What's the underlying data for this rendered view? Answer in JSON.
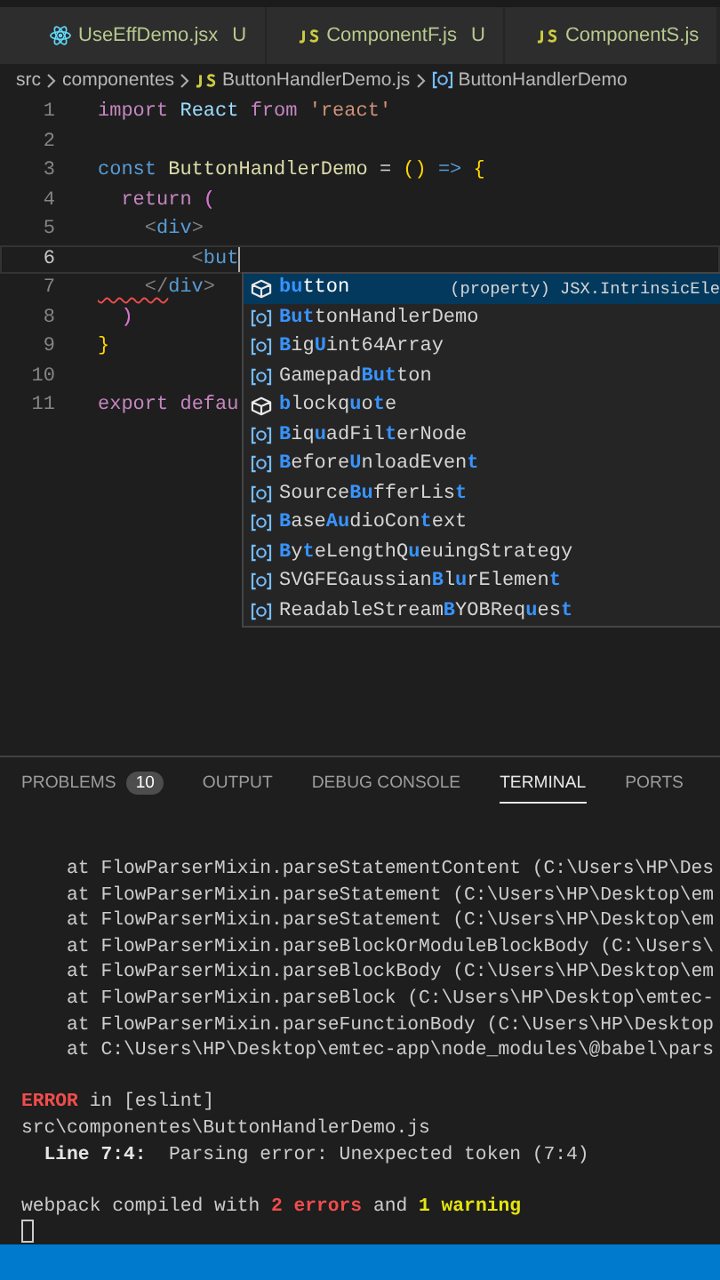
{
  "editor_tabs": [
    {
      "label": "UseEffDemo.jsx",
      "kind": "jsx",
      "status": "U",
      "selected": false
    },
    {
      "label": "ComponentF.js",
      "kind": "js",
      "status": "U",
      "selected": false
    },
    {
      "label": "ComponentS.js",
      "kind": "js",
      "selected": false
    }
  ],
  "breadcrumb": [
    {
      "label": "src",
      "kind": "folder"
    },
    {
      "label": "componentes",
      "kind": "folder"
    },
    {
      "label": "ButtonHandlerDemo.js",
      "kind": "file"
    },
    {
      "label": "ButtonHandlerDemo",
      "kind": "symbol"
    }
  ],
  "code_lines": [
    {
      "number": "1",
      "current": false,
      "error": false,
      "tokens": [
        {
          "text": "import ",
          "kind": "control"
        },
        {
          "text": "React ",
          "kind": "variable"
        },
        {
          "text": "from ",
          "kind": "control"
        },
        {
          "text": "'react'",
          "kind": "string"
        }
      ]
    },
    {
      "number": "2",
      "current": false,
      "error": false
    },
    {
      "number": "3",
      "current": false,
      "error": false,
      "tokens": [
        {
          "text": "const ",
          "kind": "keyword"
        },
        {
          "text": "ButtonHandlerDemo ",
          "kind": "function"
        },
        {
          "text": "= ",
          "kind": "plain"
        },
        {
          "text": "() ",
          "kind": "bracket"
        },
        {
          "text": "=> ",
          "kind": "keyword"
        },
        {
          "text": "{",
          "kind": "bracket"
        }
      ]
    },
    {
      "number": "4",
      "current": false,
      "error": false,
      "tokens": [
        {
          "text": "  return ",
          "kind": "control"
        },
        {
          "text": "(",
          "kind": "match"
        }
      ]
    },
    {
      "number": "5",
      "current": false,
      "error": false,
      "tokens": [
        {
          "text": "    <",
          "kind": "tagpunct"
        },
        {
          "text": "div",
          "kind": "tag"
        },
        {
          "text": ">",
          "kind": "tagpunct"
        }
      ]
    },
    {
      "number": "6",
      "current": true,
      "error": false,
      "tokens": [
        {
          "text": "        <",
          "kind": "tagpunct"
        },
        {
          "text": "but",
          "kind": "tag"
        }
      ]
    },
    {
      "number": "7",
      "current": false,
      "error": true,
      "tokens": [
        {
          "text": "    </",
          "kind": "tagpunct"
        },
        {
          "text": "div",
          "kind": "tag"
        },
        {
          "text": ">",
          "kind": "tagpunct"
        }
      ]
    },
    {
      "number": "8",
      "current": false,
      "error": false,
      "tokens": [
        {
          "text": "  )",
          "kind": "match"
        }
      ]
    },
    {
      "number": "9",
      "current": false,
      "error": false,
      "tokens": [
        {
          "text": "}",
          "kind": "bracket"
        }
      ]
    },
    {
      "number": "10",
      "current": false,
      "error": false
    },
    {
      "number": "11",
      "current": false,
      "error": false,
      "tokens": [
        {
          "text": "export ",
          "kind": "control"
        },
        {
          "text": "defau",
          "kind": "control"
        }
      ]
    }
  ],
  "suggestions": [
    {
      "kind": "property",
      "selected": true,
      "label": "**bu**tton",
      "detail": "(property) JSX.IntrinsicEle"
    },
    {
      "kind": "variable",
      "selected": false,
      "label": "**But**tonHandlerDemo"
    },
    {
      "kind": "variable",
      "selected": false,
      "label": "**B**ig**U**int64Array"
    },
    {
      "kind": "variable",
      "selected": false,
      "label": "Gamepad**But**ton"
    },
    {
      "kind": "property",
      "selected": false,
      "label": "**b**lockq**u**o**t**e"
    },
    {
      "kind": "variable",
      "selected": false,
      "label": "**B**iq**u**adFil**t**erNode"
    },
    {
      "kind": "variable",
      "selected": false,
      "label": "**B**efore**U**nloadEven**t**"
    },
    {
      "kind": "variable",
      "selected": false,
      "label": "Source**Bu**fferLis**t**"
    },
    {
      "kind": "variable",
      "selected": false,
      "label": "**B**ase**Au**dioCon**t**ext"
    },
    {
      "kind": "variable",
      "selected": false,
      "label": "**B**y**t**eLengthQ**u**euingStrategy"
    },
    {
      "kind": "variable",
      "selected": false,
      "label": "SVGFEGaussian**B**l**u**rElemen**t**"
    },
    {
      "kind": "variable",
      "selected": false,
      "label": "ReadableStream**B**YOBReq**u**es**t**"
    }
  ],
  "panel_tabs": [
    {
      "label": "PROBLEMS",
      "badge": "10",
      "selected": false
    },
    {
      "label": "OUTPUT",
      "selected": false
    },
    {
      "label": "DEBUG CONSOLE",
      "selected": false
    },
    {
      "label": "TERMINAL",
      "selected": true
    },
    {
      "label": "PORTS",
      "selected": false
    }
  ],
  "terminal_lines": [
    [
      {
        "text": "    at FlowParserMixin.parseStatementContent (C:\\Users\\HP\\Des",
        "kind": "plain"
      }
    ],
    [
      {
        "text": "    at FlowParserMixin.parseStatement (C:\\Users\\HP\\Desktop\\em",
        "kind": "plain"
      }
    ],
    [
      {
        "text": "    at FlowParserMixin.parseStatement (C:\\Users\\HP\\Desktop\\em",
        "kind": "plain"
      }
    ],
    [
      {
        "text": "    at FlowParserMixin.parseBlockOrModuleBlockBody (C:\\Users\\",
        "kind": "plain"
      }
    ],
    [
      {
        "text": "    at FlowParserMixin.parseBlockBody (C:\\Users\\HP\\Desktop\\em",
        "kind": "plain"
      }
    ],
    [
      {
        "text": "    at FlowParserMixin.parseBlock (C:\\Users\\HP\\Desktop\\emtec-",
        "kind": "plain"
      }
    ],
    [
      {
        "text": "    at FlowParserMixin.parseFunctionBody (C:\\Users\\HP\\Desktop",
        "kind": "plain"
      }
    ],
    [
      {
        "text": "    at C:\\Users\\HP\\Desktop\\emtec-app\\node_modules\\@babel\\pars",
        "kind": "plain"
      }
    ],
    [
      {
        "text": "ERROR",
        "kind": "error"
      },
      {
        "text": " in [eslint]",
        "kind": "plain"
      }
    ],
    [
      {
        "text": "src\\componentes\\ButtonHandlerDemo.js",
        "kind": "plain"
      }
    ],
    [
      {
        "text": "  Line 7:4:",
        "kind": "bold"
      },
      {
        "text": "  Parsing error: Unexpected token (7:4)",
        "kind": "plain"
      }
    ],
    [
      {
        "text": "webpack compiled with ",
        "kind": "plain"
      },
      {
        "text": "2 errors",
        "kind": "error"
      },
      {
        "text": " and ",
        "kind": "plain"
      },
      {
        "text": "1 warning",
        "kind": "warning"
      }
    ]
  ]
}
